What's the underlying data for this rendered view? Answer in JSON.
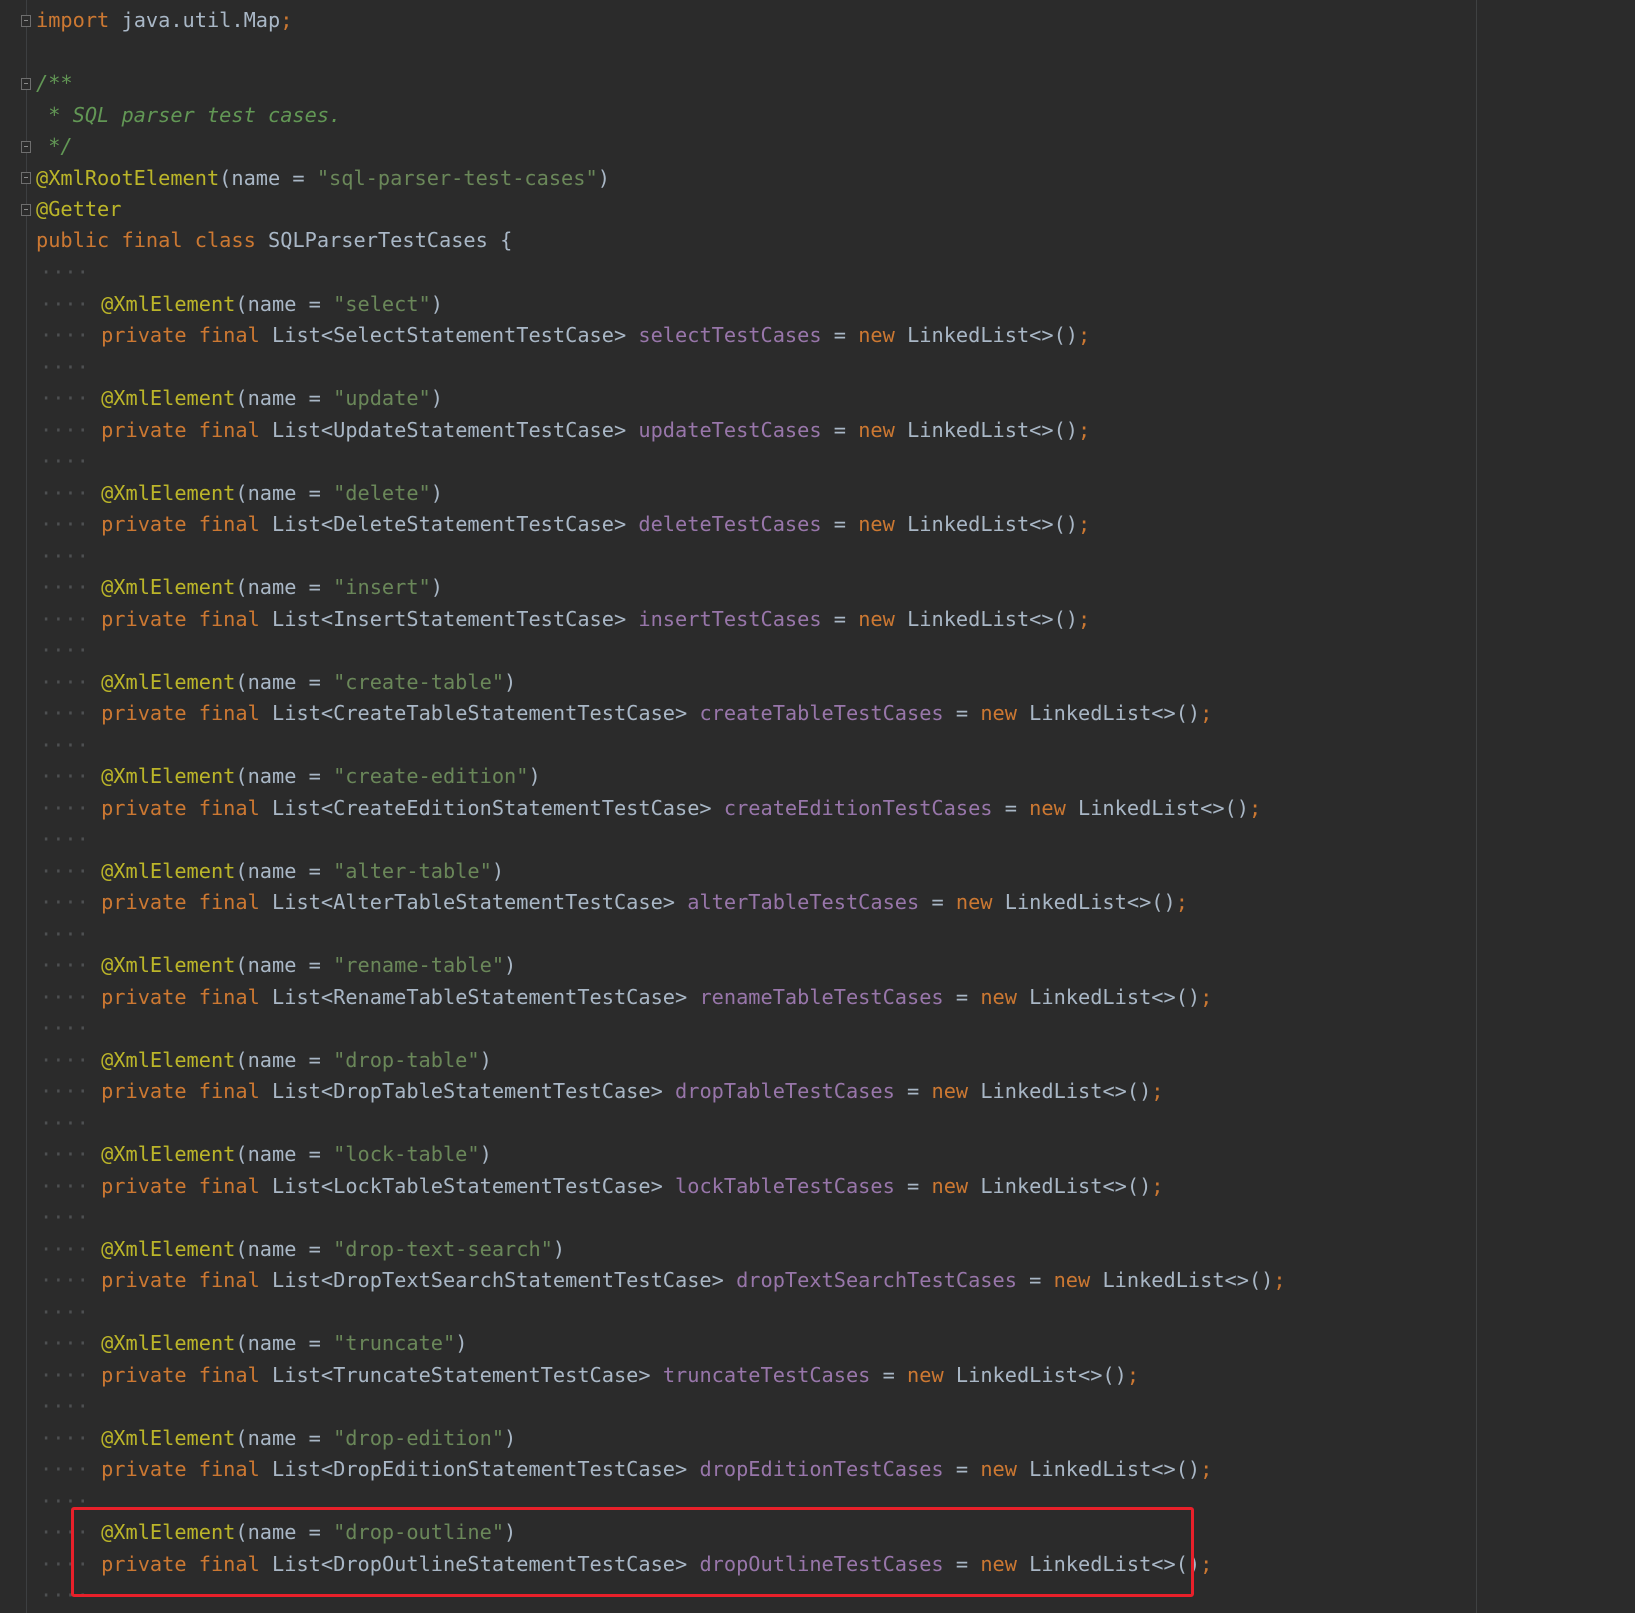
{
  "editor": {
    "language": "java",
    "colors": {
      "background": "#2b2b2b",
      "keyword": "#cc7832",
      "annotation": "#bbb529",
      "string": "#6a8759",
      "field": "#9876aa",
      "comment": "#629755",
      "plain": "#a9b7c6",
      "highlight_border": "#e8202a"
    },
    "header": {
      "import_keyword": "import",
      "import_target": "java.util.Map",
      "import_semicolon": ";",
      "doc_open": "/**",
      "doc_text": " * SQL parser test cases.",
      "doc_close": " */",
      "root_annotation": "@XmlRootElement",
      "root_annotation_args_open": "(name = ",
      "root_annotation_value": "\"sql-parser-test-cases\"",
      "root_annotation_close": ")",
      "getter_annotation": "@Getter",
      "class_mod_public": "public",
      "class_mod_final": "final",
      "class_keyword": "class",
      "class_name": "SQLParserTestCases",
      "class_brace": "{"
    },
    "field_common": {
      "annotation": "@XmlElement",
      "args_open": "(name = ",
      "args_close": ")",
      "mod_private": "private",
      "mod_final": "final",
      "list_open": "List<",
      "list_close": ">",
      "assign": "=",
      "new_keyword": "new",
      "initializer": "LinkedList<>()",
      "semicolon": ";",
      "indent_dots": "····",
      "blank_guide": "····"
    },
    "fields": [
      {
        "element_name": "\"select\"",
        "type": "SelectStatementTestCase",
        "field": "selectTestCases"
      },
      {
        "element_name": "\"update\"",
        "type": "UpdateStatementTestCase",
        "field": "updateTestCases"
      },
      {
        "element_name": "\"delete\"",
        "type": "DeleteStatementTestCase",
        "field": "deleteTestCases"
      },
      {
        "element_name": "\"insert\"",
        "type": "InsertStatementTestCase",
        "field": "insertTestCases"
      },
      {
        "element_name": "\"create-table\"",
        "type": "CreateTableStatementTestCase",
        "field": "createTableTestCases"
      },
      {
        "element_name": "\"create-edition\"",
        "type": "CreateEditionStatementTestCase",
        "field": "createEditionTestCases"
      },
      {
        "element_name": "\"alter-table\"",
        "type": "AlterTableStatementTestCase",
        "field": "alterTableTestCases"
      },
      {
        "element_name": "\"rename-table\"",
        "type": "RenameTableStatementTestCase",
        "field": "renameTableTestCases"
      },
      {
        "element_name": "\"drop-table\"",
        "type": "DropTableStatementTestCase",
        "field": "dropTableTestCases"
      },
      {
        "element_name": "\"lock-table\"",
        "type": "LockTableStatementTestCase",
        "field": "lockTableTestCases"
      },
      {
        "element_name": "\"drop-text-search\"",
        "type": "DropTextSearchStatementTestCase",
        "field": "dropTextSearchTestCases"
      },
      {
        "element_name": "\"truncate\"",
        "type": "TruncateStatementTestCase",
        "field": "truncateTestCases"
      },
      {
        "element_name": "\"drop-edition\"",
        "type": "DropEditionStatementTestCase",
        "field": "dropEditionTestCases"
      },
      {
        "element_name": "\"drop-outline\"",
        "type": "DropOutlineStatementTestCase",
        "field": "dropOutlineTestCases"
      }
    ]
  }
}
